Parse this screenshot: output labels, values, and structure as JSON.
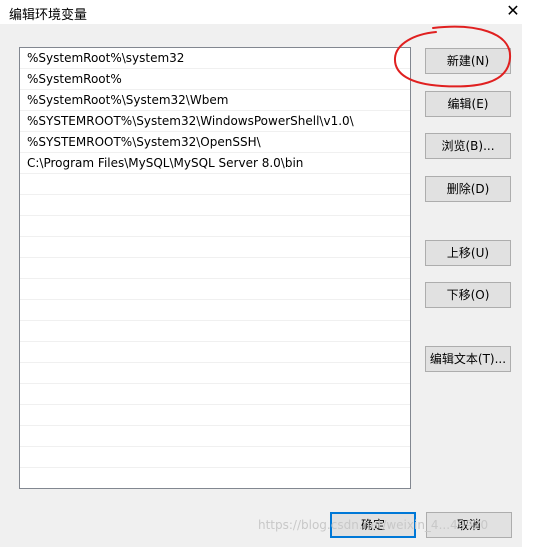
{
  "window": {
    "title": "编辑环境变量",
    "close_glyph": "✕"
  },
  "paths": [
    "%SystemRoot%\\system32",
    "%SystemRoot%",
    "%SystemRoot%\\System32\\Wbem",
    "%SYSTEMROOT%\\System32\\WindowsPowerShell\\v1.0\\",
    "%SYSTEMROOT%\\System32\\OpenSSH\\",
    "C:\\Program Files\\MySQL\\MySQL Server 8.0\\bin",
    "",
    "",
    "",
    "",
    "",
    "",
    "",
    "",
    "",
    "",
    "",
    "",
    "",
    "",
    ""
  ],
  "buttons": {
    "new": "新建(N)",
    "edit": "编辑(E)",
    "browse": "浏览(B)...",
    "delete": "删除(D)",
    "move_up": "上移(U)",
    "move_down": "下移(O)",
    "edit_text": "编辑文本(T)...",
    "ok": "确定",
    "cancel": "取消"
  },
  "annotation": {
    "color": "#e02020"
  },
  "watermark": "https://blog.csdn.net/weixin_4...49920"
}
